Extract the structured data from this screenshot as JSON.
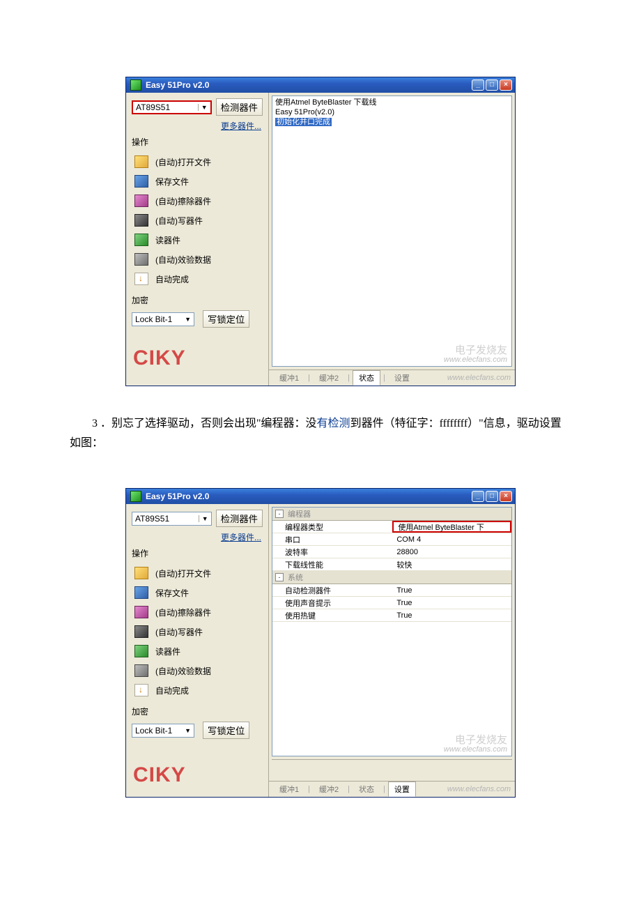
{
  "doc": {
    "paragraph_prefix": "3 ．别忘了选择驱动，否则会出现\"编程器：没",
    "paragraph_link": "有检测",
    "paragraph_suffix": "到器件（特征字：ffffffff）\"信息，驱动设置如图："
  },
  "shot1": {
    "title": "Easy 51Pro v2.0",
    "device": "AT89S51",
    "detect_btn": "检测器件",
    "more_link": "更多器件...",
    "ops_header": "操作",
    "ops": {
      "open": "(自动)打开文件",
      "save": "保存文件",
      "erase": "(自动)擦除器件",
      "write": "(自动)写器件",
      "read": "读器件",
      "verify": "(自动)效验数据",
      "auto": "自动完成"
    },
    "encrypt_label": "加密",
    "lockbit": "Lock Bit-1",
    "lock_btn": "写锁定位",
    "log": {
      "l1": "使用Atmel ByteBlaster 下载线",
      "l2": "Easy 51Pro(v2.0)",
      "l3": "初始化并口完成"
    },
    "tabs": {
      "b1": "缓冲1",
      "b2": "缓冲2",
      "status": "状态",
      "settings": "设置"
    },
    "wm_ciky": "CIKY",
    "wm_elec_cn": "电子发烧友",
    "wm_elec_url": "www.elecfans.com"
  },
  "shot2": {
    "title": "Easy 51Pro v2.0",
    "device": "AT89S51",
    "detect_btn": "检测器件",
    "more_link": "更多器件...",
    "ops_header": "操作",
    "ops": {
      "open": "(自动)打开文件",
      "save": "保存文件",
      "erase": "(自动)擦除器件",
      "write": "(自动)写器件",
      "read": "读器件",
      "verify": "(自动)效验数据",
      "auto": "自动完成"
    },
    "encrypt_label": "加密",
    "lockbit": "Lock Bit-1",
    "lock_btn": "写锁定位",
    "groups": {
      "g1": "编程器",
      "g2": "系统"
    },
    "settings": {
      "k_type": "编程器类型",
      "v_type": "使用Atmel ByteBlaster 下",
      "k_port": "串口",
      "v_port": "COM 4",
      "k_baud": "波特率",
      "v_baud": "28800",
      "k_perf": "下载线性能",
      "v_perf": "较快",
      "k_autod": "自动检测器件",
      "v_autod": "True",
      "k_sound": "使用声音提示",
      "v_sound": "True",
      "k_hot": "使用热键",
      "v_hot": "True"
    },
    "tabs": {
      "b1": "缓冲1",
      "b2": "缓冲2",
      "status": "状态",
      "settings": "设置"
    },
    "wm_ciky": "CIKY",
    "wm_elec_cn": "电子发烧友",
    "wm_elec_url": "www.elecfans.com"
  }
}
